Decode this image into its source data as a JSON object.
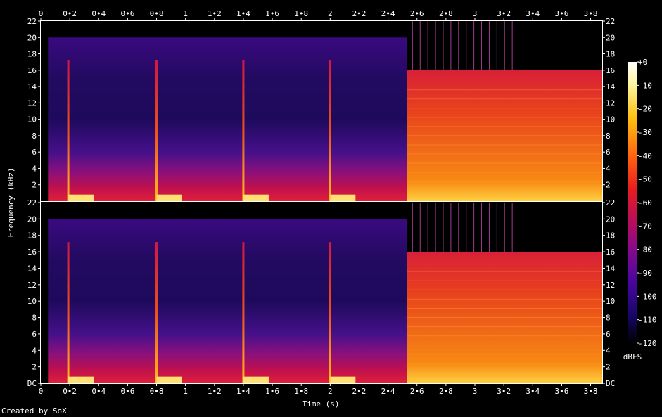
{
  "chart_data": {
    "type": "heatmap",
    "title": "",
    "xlabel": "Time (s)",
    "ylabel": "Frequency (kHz)",
    "xlim": [
      0,
      3.88
    ],
    "ylim": [
      0,
      22
    ],
    "x_ticks": [
      "0",
      "0•2",
      "0•4",
      "0•6",
      "0•8",
      "1",
      "1•2",
      "1•4",
      "1•6",
      "1•8",
      "2",
      "2•2",
      "2•4",
      "2•6",
      "2•8",
      "3",
      "3•2",
      "3•4",
      "3•6",
      "3•8"
    ],
    "x_tick_values": [
      0,
      0.2,
      0.4,
      0.6,
      0.8,
      1.0,
      1.2,
      1.4,
      1.6,
      1.8,
      2.0,
      2.2,
      2.4,
      2.6,
      2.8,
      3.0,
      3.2,
      3.4,
      3.6,
      3.8
    ],
    "y_ticks_upper": [
      "22",
      "20",
      "18",
      "16",
      "14",
      "12",
      "10",
      "8",
      "6",
      "4",
      "2"
    ],
    "y_ticks_lower": [
      "22",
      "20",
      "18",
      "16",
      "14",
      "12",
      "10",
      "8",
      "6",
      "4",
      "2",
      "DC"
    ],
    "y_tick_values": [
      22,
      20,
      18,
      16,
      14,
      12,
      10,
      8,
      6,
      4,
      2,
      0
    ],
    "channels": 2,
    "colorbar": {
      "label": "dBFS",
      "ticks": [
        "+0",
        "-10",
        "-20",
        "-30",
        "-40",
        "-50",
        "-60",
        "-70",
        "-80",
        "-90",
        "-100",
        "-110",
        "-120"
      ],
      "range": [
        -120,
        0
      ]
    },
    "events": [
      {
        "type": "transient",
        "time": 0.19
      },
      {
        "type": "transient",
        "time": 0.8
      },
      {
        "type": "transient",
        "time": 1.4
      },
      {
        "type": "transient",
        "time": 2.0
      }
    ],
    "segments": [
      {
        "start": 0.05,
        "end": 2.53,
        "level": "quiet",
        "max_freq_khz": 20
      },
      {
        "start": 2.53,
        "end": 3.88,
        "level": "loud",
        "max_freq_khz": 16
      }
    ]
  },
  "footer": {
    "credit": "Created by SoX"
  },
  "colors": {
    "background": "#000000",
    "text": "#ffffff",
    "frame": "#ffffff"
  }
}
